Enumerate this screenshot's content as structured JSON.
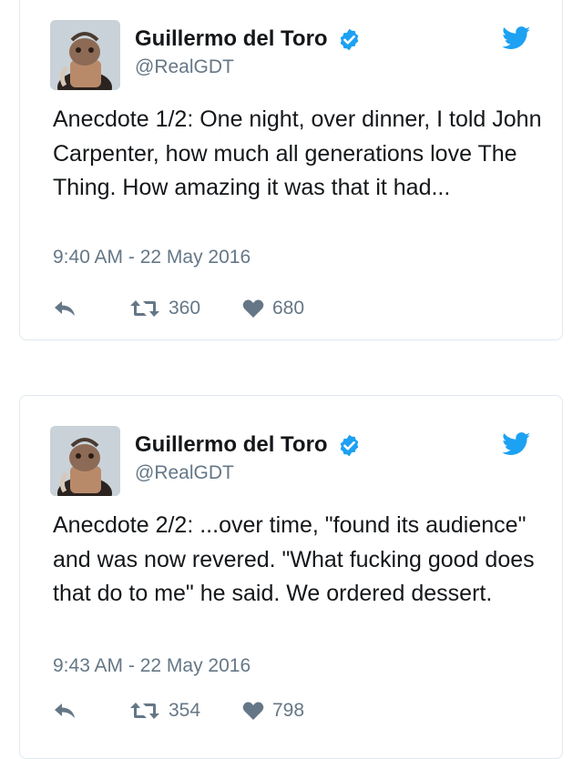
{
  "colors": {
    "verified": "#1da1f2",
    "twitter_bird": "#1da1f2",
    "text": "#14171a",
    "muted": "#657786",
    "action_icon": "#657786",
    "border": "#e1e8ed"
  },
  "tweets": [
    {
      "author_name": "Guillermo del Toro",
      "handle": "@RealGDT",
      "text": "Anecdote 1/2: One night, over dinner, I told John Carpenter, how much all generations love The Thing. How amazing it was that it had...",
      "timestamp": "9:40 AM - 22 May 2016",
      "retweets": "360",
      "likes": "680",
      "icons": [
        "verified-badge-icon",
        "twitter-bird-icon",
        "reply-icon",
        "retweet-icon",
        "heart-icon"
      ]
    },
    {
      "author_name": "Guillermo del Toro",
      "handle": "@RealGDT",
      "text": "Anecdote 2/2: ...over time, \"found its audience\" and was now revered. \"What fucking good does that do to me\" he said. We ordered dessert.",
      "timestamp": "9:43 AM - 22 May 2016",
      "retweets": "354",
      "likes": "798",
      "icons": [
        "verified-badge-icon",
        "twitter-bird-icon",
        "reply-icon",
        "retweet-icon",
        "heart-icon"
      ]
    }
  ]
}
